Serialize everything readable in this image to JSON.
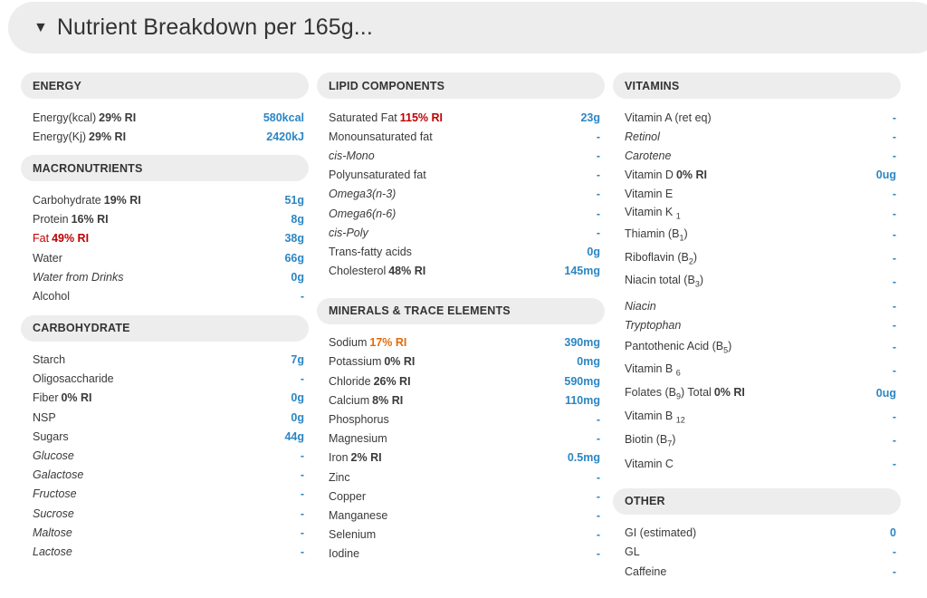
{
  "header": {
    "toggle_icon": "▼",
    "title": "Nutrient Breakdown per 165g..."
  },
  "colors": {
    "value_blue": "#2c86c4",
    "warn_red": "#c00000",
    "warn_orange": "#e36c09",
    "panel_grey": "#ededed"
  },
  "energy": {
    "title": "ENERGY",
    "rows": [
      {
        "label": "Energy(kcal)",
        "ri": "29% RI",
        "value": "580kcal"
      },
      {
        "label": "Energy(Kj)",
        "ri": "29% RI",
        "value": "2420kJ"
      }
    ]
  },
  "macronutrients": {
    "title": "MACRONUTRIENTS",
    "rows": [
      {
        "label": "Carbohydrate",
        "ri": "19% RI",
        "value": "51g"
      },
      {
        "label": "Protein",
        "ri": "16% RI",
        "value": "8g"
      },
      {
        "label": "Fat",
        "ri": "49% RI",
        "value": "38g"
      },
      {
        "label": "Water",
        "value": "66g"
      },
      {
        "label": "Water from Drinks",
        "value": "0g"
      },
      {
        "label": "Alcohol",
        "value": "-"
      }
    ]
  },
  "carbohydrate": {
    "title": "CARBOHYDRATE",
    "rows": [
      {
        "label": "Starch",
        "value": "7g"
      },
      {
        "label": "Oligosaccharide",
        "value": "-"
      },
      {
        "label": "Fiber",
        "ri": "0% RI",
        "value": "0g"
      },
      {
        "label": "NSP",
        "value": "0g"
      },
      {
        "label": "Sugars",
        "value": "44g"
      },
      {
        "label": "Glucose",
        "value": "-"
      },
      {
        "label": "Galactose",
        "value": "-"
      },
      {
        "label": "Fructose",
        "value": "-"
      },
      {
        "label": "Sucrose",
        "value": "-"
      },
      {
        "label": "Maltose",
        "value": "-"
      },
      {
        "label": "Lactose",
        "value": "-"
      }
    ]
  },
  "lipids": {
    "title": "LIPID COMPONENTS",
    "rows": [
      {
        "label": "Saturated Fat",
        "ri": "115% RI",
        "value": "23g"
      },
      {
        "label": "Monounsaturated fat",
        "value": "-"
      },
      {
        "label": "cis-Mono",
        "value": "-"
      },
      {
        "label": "Polyunsaturated fat",
        "value": "-"
      },
      {
        "label": "Omega3(n-3)",
        "value": "-"
      },
      {
        "label": "Omega6(n-6)",
        "value": "-"
      },
      {
        "label": "cis-Poly",
        "value": "-"
      },
      {
        "label": "Trans-fatty acids",
        "value": "0g"
      },
      {
        "label": "Cholesterol",
        "ri": "48% RI",
        "value": "145mg"
      }
    ]
  },
  "minerals": {
    "title": "MINERALS & TRACE ELEMENTS",
    "rows": [
      {
        "label": "Sodium",
        "ri": "17% RI",
        "value": "390mg"
      },
      {
        "label": "Potassium",
        "ri": "0% RI",
        "value": "0mg"
      },
      {
        "label": "Chloride",
        "ri": "26% RI",
        "value": "590mg"
      },
      {
        "label": "Calcium",
        "ri": "8% RI",
        "value": "110mg"
      },
      {
        "label": "Phosphorus",
        "value": "-"
      },
      {
        "label": "Magnesium",
        "value": "-"
      },
      {
        "label": "Iron",
        "ri": "2% RI",
        "value": "0.5mg"
      },
      {
        "label": "Zinc",
        "value": "-"
      },
      {
        "label": "Copper",
        "value": "-"
      },
      {
        "label": "Manganese",
        "value": "-"
      },
      {
        "label": "Selenium",
        "value": "-"
      },
      {
        "label": "Iodine",
        "value": "-"
      }
    ]
  },
  "vitamins": {
    "title": "VITAMINS",
    "rows": [
      {
        "label": "Vitamin A (ret eq)",
        "value": "-"
      },
      {
        "label": "Retinol",
        "value": "-"
      },
      {
        "label": "Carotene",
        "value": "-"
      },
      {
        "label": "Vitamin D",
        "ri": "0% RI",
        "value": "0ug"
      },
      {
        "label": "Vitamin E",
        "value": "-"
      },
      {
        "label": "Vitamin K",
        "sub": "1",
        "value": "-"
      },
      {
        "label": "Thiamin (B",
        "sub": "1",
        "suffix": ")",
        "value": "-"
      },
      {
        "label": "Riboflavin (B",
        "sub": "2",
        "suffix": ")",
        "value": "-"
      },
      {
        "label": "Niacin total (B",
        "sub": "3",
        "suffix": ")",
        "value": "-"
      },
      {
        "label": "Niacin",
        "value": "-"
      },
      {
        "label": "Tryptophan",
        "value": "-"
      },
      {
        "label": "Pantothenic Acid (B",
        "sub": "5",
        "suffix": ")",
        "value": "-"
      },
      {
        "label": "Vitamin B",
        "sub": "6",
        "value": "-"
      },
      {
        "label": "Folates (B",
        "sub": "9",
        "suffix": ") Total",
        "ri": "0% RI",
        "value": "0ug"
      },
      {
        "label": "Vitamin B",
        "sub": "12",
        "value": "-"
      },
      {
        "label": "Biotin (B",
        "sub": "7",
        "suffix": ")",
        "value": "-"
      },
      {
        "label": "Vitamin C",
        "value": "-"
      }
    ]
  },
  "other": {
    "title": "OTHER",
    "rows": [
      {
        "label": "GI (estimated)",
        "value": "0"
      },
      {
        "label": "GL",
        "value": "-"
      },
      {
        "label": "Caffeine",
        "value": "-"
      }
    ]
  }
}
